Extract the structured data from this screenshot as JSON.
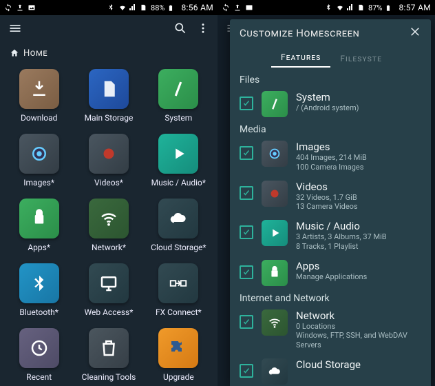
{
  "left": {
    "status": {
      "battery": "88%",
      "time": "8:56 AM"
    },
    "breadcrumb": "Home",
    "grid": [
      {
        "label": "Download",
        "bg": "bg-brown",
        "icon": "download"
      },
      {
        "label": "Main Storage",
        "bg": "bg-blue",
        "icon": "sdcard"
      },
      {
        "label": "System",
        "bg": "bg-green",
        "icon": "slash"
      },
      {
        "label": "Images*",
        "bg": "bg-grey",
        "icon": "camera"
      },
      {
        "label": "Videos*",
        "bg": "bg-grey",
        "icon": "record"
      },
      {
        "label": "Music / Audio*",
        "bg": "bg-teal",
        "icon": "play"
      },
      {
        "label": "Apps*",
        "bg": "bg-green",
        "icon": "android"
      },
      {
        "label": "Network*",
        "bg": "bg-olive",
        "icon": "wifi"
      },
      {
        "label": "Cloud Storage*",
        "bg": "bg-slate",
        "icon": "cloud"
      },
      {
        "label": "Bluetooth*",
        "bg": "bg-blue2",
        "icon": "bluetooth"
      },
      {
        "label": "Web Access*",
        "bg": "bg-slate",
        "icon": "monitor"
      },
      {
        "label": "FX Connect*",
        "bg": "bg-slate",
        "icon": "connect"
      },
      {
        "label": "Recent",
        "bg": "bg-purple",
        "icon": "clock"
      },
      {
        "label": "Cleaning Tools",
        "bg": "bg-dgrey",
        "icon": "trash"
      },
      {
        "label": "Upgrade",
        "bg": "bg-orange",
        "icon": "puzzle"
      }
    ]
  },
  "right": {
    "status": {
      "battery": "87%",
      "time": "8:57 AM"
    },
    "sheet": {
      "title": "Customize Homescreen",
      "tabs": {
        "active": "Features",
        "inactive": "Filesyste"
      },
      "sections": [
        {
          "label": "Files",
          "items": [
            {
              "title": "System",
              "subtitle": "/ (Android system)",
              "bg": "bg-green",
              "icon": "slash",
              "checked": true
            }
          ]
        },
        {
          "label": "Media",
          "items": [
            {
              "title": "Images",
              "subtitle": "404 Images, 214 MiB\n100 Camera Images",
              "bg": "bg-grey",
              "icon": "camera",
              "checked": true
            },
            {
              "title": "Videos",
              "subtitle": "32 Videos, 1.7 GiB\n13 Camera Videos",
              "bg": "bg-grey",
              "icon": "record",
              "checked": true
            },
            {
              "title": "Music / Audio",
              "subtitle": "3 Artists, 3 Albums, 37 MiB\n8 Tracks, 1 Playlist",
              "bg": "bg-teal",
              "icon": "play",
              "checked": true
            },
            {
              "title": "Apps",
              "subtitle": "Manage Applications",
              "bg": "bg-green",
              "icon": "android",
              "checked": true
            }
          ]
        },
        {
          "label": "Internet and Network",
          "items": [
            {
              "title": "Network",
              "subtitle": "0 Locations\nWindows, FTP, SSH, and WebDAV Servers",
              "bg": "bg-olive",
              "icon": "wifi",
              "checked": true
            },
            {
              "title": "Cloud Storage",
              "subtitle": "",
              "bg": "bg-slate",
              "icon": "cloud",
              "checked": true
            }
          ]
        }
      ]
    }
  }
}
